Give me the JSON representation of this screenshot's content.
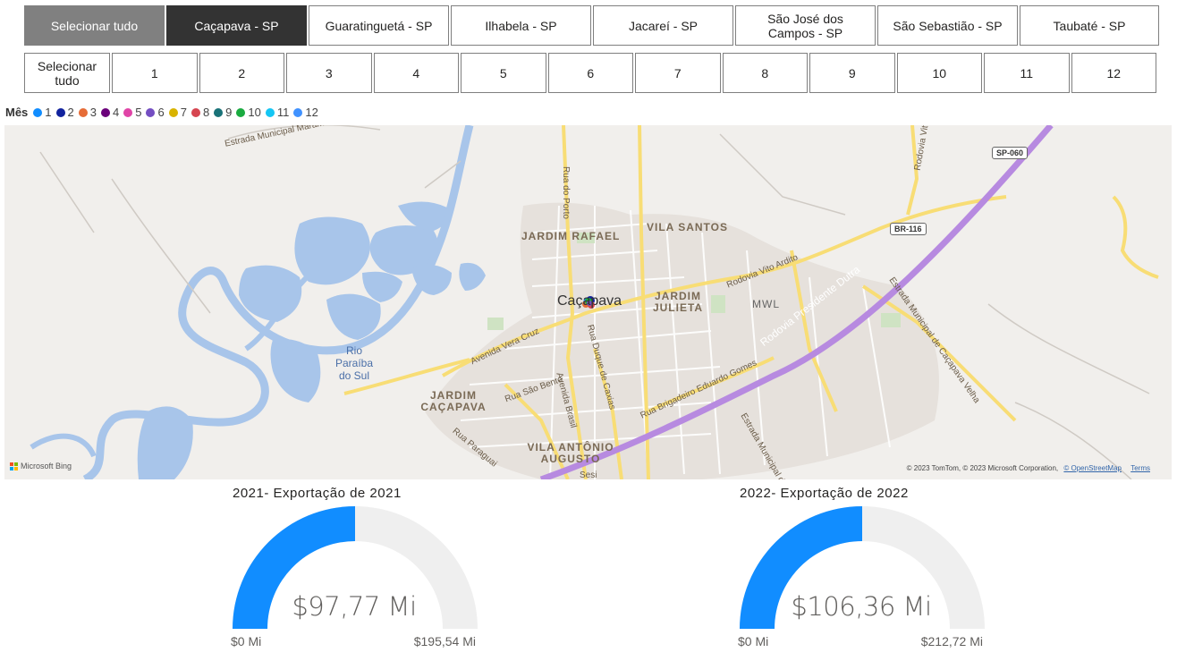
{
  "city_slicer": {
    "items": [
      {
        "label": "Selecionar tudo",
        "state": "partial"
      },
      {
        "label": "Caçapava - SP",
        "state": "selected"
      },
      {
        "label": "Guaratinguetá - SP",
        "state": "normal"
      },
      {
        "label": "Ilhabela - SP",
        "state": "normal"
      },
      {
        "label": "Jacareí - SP",
        "state": "normal"
      },
      {
        "label": "São José dos Campos - SP",
        "state": "normal"
      },
      {
        "label": "São Sebastião - SP",
        "state": "normal"
      },
      {
        "label": "Taubaté - SP",
        "state": "normal"
      }
    ]
  },
  "month_slicer": {
    "items": [
      "Selecionar tudo",
      "1",
      "2",
      "3",
      "4",
      "5",
      "6",
      "7",
      "8",
      "9",
      "10",
      "11",
      "12"
    ]
  },
  "legend": {
    "title": "Mês",
    "items": [
      {
        "label": "1",
        "color": "#118DFF"
      },
      {
        "label": "2",
        "color": "#12239E"
      },
      {
        "label": "3",
        "color": "#E66C37"
      },
      {
        "label": "4",
        "color": "#6B007B"
      },
      {
        "label": "5",
        "color": "#E044A7"
      },
      {
        "label": "6",
        "color": "#744EC2"
      },
      {
        "label": "7",
        "color": "#D9B300"
      },
      {
        "label": "8",
        "color": "#D64550"
      },
      {
        "label": "9",
        "color": "#197278"
      },
      {
        "label": "10",
        "color": "#1AAB40"
      },
      {
        "label": "11",
        "color": "#15C6F4"
      },
      {
        "label": "12",
        "color": "#4092FF"
      }
    ]
  },
  "map": {
    "city_name": "Caçapava",
    "districts": [
      "JARDIM RAFAEL",
      "VILA SANTOS",
      "JARDIM JULIETA",
      "JARDIM CAÇAPAVA",
      "VILA ANTÔNIO AUGUSTO",
      "MWL"
    ],
    "roads": [
      "Estrada Municipal Marambaia",
      "Rua do Porto",
      "Avenida Vera Cruz",
      "Rua Duque de Caxias",
      "Rua São Bento",
      "Avenida Brasil",
      "Rua Paraguai",
      "Rodovia Vito Ardito",
      "Rodovia Presidente Dutra",
      "Rua Brigadeiro Eduardo Gomes",
      "Estrada Municipal de Caçapava Velha",
      "Estrada Municipal da Germ",
      "Rodovia Vit",
      "Sesi"
    ],
    "river": "Rio Paraíba do Sul",
    "shields": [
      "SP-060",
      "BR-116"
    ],
    "attribution_logo": "Microsoft Bing",
    "copyright": "© 2023 TomTom, © 2023 Microsoft Corporation,",
    "osm_link": "© OpenStreetMap",
    "terms_link": "Terms"
  },
  "gauges": [
    {
      "title": "2021- Exportação de 2021",
      "value_label": "$97,77 Mi",
      "min_label": "$0 Mi",
      "max_label": "$195,54 Mi",
      "value": 97.77,
      "max": 195.54,
      "fill_color": "#118DFF"
    },
    {
      "title": "2022- Exportação de 2022",
      "value_label": "$106,36 Mi",
      "min_label": "$0 Mi",
      "max_label": "$212,72 Mi",
      "value": 106.36,
      "max": 212.72,
      "fill_color": "#118DFF"
    }
  ]
}
